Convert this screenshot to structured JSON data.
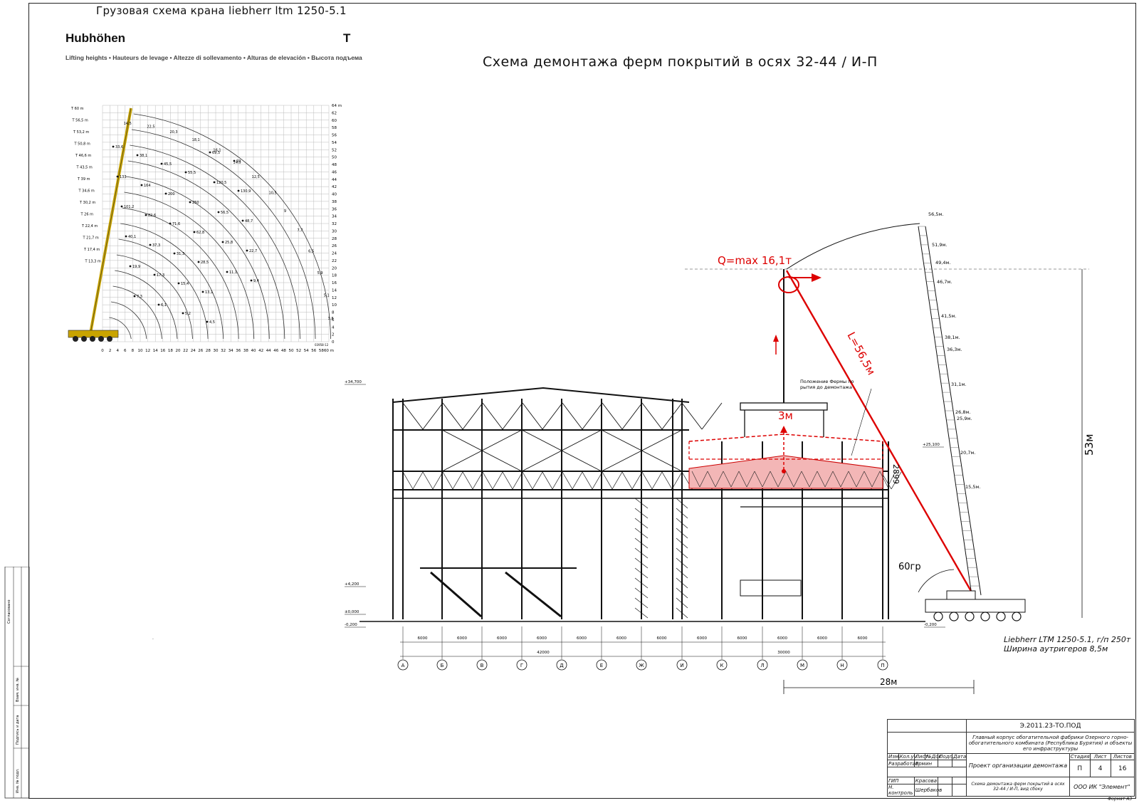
{
  "header": {
    "crane_title": "Грузовая схема крана liebherr ltm 1250-5.1",
    "main_title": "Схема демонтажа ферм покрытий в осях 32-44 / И-П"
  },
  "chart": {
    "title": "Hubhöhen",
    "unit": "T",
    "subtitle": "Lifting heights • Hauteurs de levage • Altezze di sollevamento • Alturas de elevación • Высота подъема",
    "x_ticks": [
      "0",
      "2",
      "4",
      "6",
      "8",
      "10",
      "12",
      "14",
      "16",
      "18",
      "20",
      "22",
      "24",
      "26",
      "28",
      "30",
      "32",
      "34",
      "36",
      "38",
      "40",
      "42",
      "44",
      "46",
      "48",
      "50",
      "52",
      "54",
      "56",
      "58",
      "60 m"
    ],
    "y_ticks": [
      "64 m",
      "62",
      "60",
      "58",
      "56",
      "54",
      "52",
      "50",
      "48",
      "46",
      "44",
      "42",
      "40",
      "38",
      "36",
      "34",
      "32",
      "30",
      "28",
      "26",
      "24",
      "22",
      "20",
      "18",
      "16",
      "14",
      "12",
      "10",
      "8",
      "6",
      "4",
      "2",
      "0"
    ],
    "boom_labels": [
      "T 60 m",
      "T 56,5 m",
      "T 53,2 m",
      "T 50,8 m",
      "T 46,6 m",
      "T 43,5 m",
      "T 39 m",
      "T 34,6 m",
      "T 30,2 m",
      "T 26 m",
      "T 22,4 m",
      "T 21,7 m",
      "T 17,4 m",
      "T 13,3 m"
    ],
    "curve_values": [
      "14,5",
      "22,5",
      "20,3",
      "18,1",
      "16,1",
      "14,3",
      "12,5",
      "10,5",
      "9",
      "7,7",
      "6,5",
      "5,9",
      "5,1",
      "3,8"
    ],
    "point_values": [
      "33,6",
      "38,1",
      "45,5",
      "55,5",
      "69,5",
      "92",
      "133",
      "164",
      "200",
      "250",
      "120,5",
      "130,9",
      "101,2",
      "82,6",
      "71,6",
      "62,8",
      "56,5",
      "48,7",
      "40,1",
      "37,3",
      "31,3",
      "28,5",
      "25,8",
      "22,7",
      "19,9",
      "17,3",
      "15,4",
      "13,1",
      "11,1",
      "9,4",
      "7,3",
      "6,1",
      "5,2",
      "4,5"
    ],
    "chart_code": "03958-12"
  },
  "section": {
    "levels": [
      "+34,700",
      "+25,100",
      "+4,200",
      "±0,000",
      "-0,200",
      "-0,200"
    ],
    "dims": [
      "6000",
      "6000",
      "6000",
      "6000",
      "6000",
      "6000",
      "6000",
      "6000",
      "6000",
      "6000",
      "6000",
      "6000"
    ],
    "dim_totals": [
      "42000",
      "30000"
    ],
    "axes": [
      "А",
      "Б",
      "В",
      "Г",
      "Д",
      "Е",
      "Ж",
      "И",
      "К",
      "Л",
      "М",
      "Н",
      "П"
    ],
    "truss_note": "Положение Фермы покрытия до демонтажа",
    "truss_height": "2899"
  },
  "annotations": {
    "load": "Q=max 16,1т",
    "boom_length": "L=56,5м",
    "lift": "3м",
    "height": "53м",
    "angle": "60гр",
    "reach": "28м",
    "mast_marks": [
      "56,5м.",
      "51,9м.",
      "49,4м.",
      "46,7м.",
      "41,5м.",
      "38,1м.",
      "36,3м.",
      "31,1м.",
      "26,8м.",
      "25,9м.",
      "20,7м.",
      "15,5м."
    ]
  },
  "crane_model": {
    "line1": "Liebherr LTM 1250-5.1, г/п 250т",
    "line2": "Ширина аутригеров 8,5м"
  },
  "stamp": {
    "code": "Э.2011.23-ТО.ПОД",
    "project": "Главный корпус обогатительной фабрики Озерного горно-обогатительного комбината (Республика Бурятия) и объекты его инфраструктуры",
    "h_izm": "Изм.",
    "h_koluch": "Кол.уч",
    "h_list": "Лист",
    "h_ndok": "№Док",
    "h_podp": "Подп.",
    "h_data": "Дата",
    "dev_role": "Разработал",
    "dev_name": "Ермин",
    "gip_role": "ГИП",
    "gip_name": "Красова",
    "nk_role": "Н. контроль",
    "nk_name": "Шербаков",
    "doc_title": "Проект организации демонтажа",
    "h_stage": "Стадия",
    "h_sheet": "Лист",
    "h_sheets": "Листов",
    "stage": "П",
    "sheet": "4",
    "sheets": "16",
    "drawing": "Схема демонтажа ферм покрытий в осях 32-44 / И-П, вид сбоку",
    "company": "ООО ИК \"Элемент\"",
    "format": "Формат А3"
  },
  "side_stamp": {
    "items": [
      "Инв. № подл.",
      "Подпись и дата",
      "Взам. инв. №",
      "Согласовано"
    ]
  }
}
